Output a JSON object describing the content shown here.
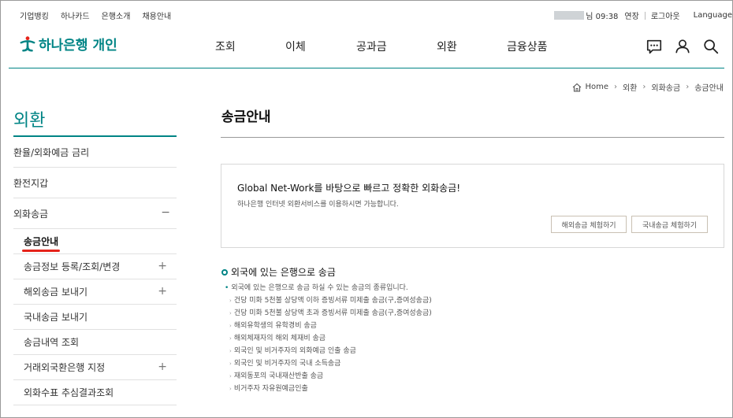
{
  "utility": {
    "links": [
      "기업뱅킹",
      "하나카드",
      "은행소개",
      "채용안내"
    ],
    "user_suffix": "님 09:38",
    "extend": "연장",
    "logout": "로그아웃",
    "language": "Language"
  },
  "header": {
    "logo_text": "하나은행 개인",
    "nav": [
      "조회",
      "이체",
      "공과금",
      "외환",
      "금융상품"
    ],
    "icons": [
      "chat-icon",
      "user-icon",
      "search-icon"
    ]
  },
  "breadcrumb": {
    "home": "Home",
    "items": [
      "외환",
      "외화송금",
      "송금안내"
    ]
  },
  "sidebar": {
    "title": "외환",
    "items": [
      {
        "label": "환율/외화예금 금리"
      },
      {
        "label": "환전지갑"
      },
      {
        "label": "외화송금",
        "toggle": "−"
      }
    ],
    "subitems": [
      {
        "label": "송금안내",
        "toggle": ""
      },
      {
        "label": "송금정보 등록/조회/변경",
        "toggle": "+"
      },
      {
        "label": "해외송금 보내기",
        "toggle": "+"
      },
      {
        "label": "국내송금 보내기",
        "toggle": ""
      },
      {
        "label": "송금내역 조회",
        "toggle": ""
      },
      {
        "label": "거래외국환은행 지정",
        "toggle": "+"
      },
      {
        "label": "외화수표 추심결과조회",
        "toggle": ""
      }
    ]
  },
  "main": {
    "title": "송금안내",
    "info_box": {
      "headline": "Global Net-Work를 바탕으로 빠르고 정확한 외화송금!",
      "subtext": "하나은행 인터넷 외환서비스를 이용하시면 가능합니다.",
      "btn_overseas": "해외송금 체험하기",
      "btn_domestic": "국내송금 체험하기"
    },
    "section_title": "외국에 있는 은행으로 송금",
    "lead": "외국에 있는 은행으로 송금 하실 수 있는 송금의 종류입니다.",
    "items": [
      "건당 미화 5천불 상당액 이하 증빙서류 미제출 송금(구,증여성송금)",
      "건당 미화 5천불 상당액 초과 증빙서류 미제출 송금(구,증여성송금)",
      "해외유학생의 유학경비 송금",
      "해외체재자의 해외 체재비 송금",
      "외국인 및 비거주자의 외화예금 인출 송금",
      "외국인 및 비거주자의 국내 소득송금",
      "재외동포의 국내재산반출 송금",
      "비거주자 자유원예금인출"
    ]
  },
  "colors": {
    "brand": "#008485",
    "accent_red": "#e5231a"
  }
}
